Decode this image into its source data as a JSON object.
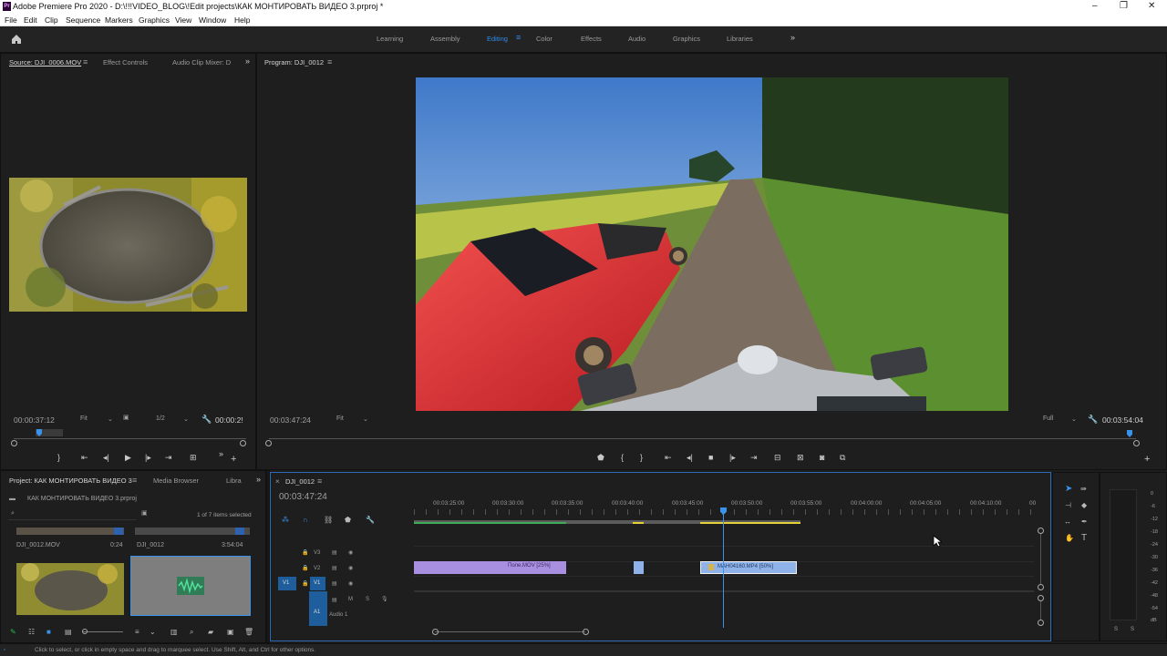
{
  "app": {
    "title": "Adobe Premiere Pro 2020 - D:\\!!!VIDEO_BLOG\\!Edit projects\\КАК МОНТИРОВАТЬ ВИДЕО 3.prproj *",
    "logo": "Pr"
  },
  "menu": [
    "File",
    "Edit",
    "Clip",
    "Sequence",
    "Markers",
    "Graphics",
    "View",
    "Window",
    "Help"
  ],
  "workspaces": [
    "Learning",
    "Assembly",
    "Editing",
    "Color",
    "Effects",
    "Audio",
    "Graphics",
    "Libraries"
  ],
  "active_workspace": "Editing",
  "source_panel": {
    "tabs": [
      "Source: DJI_0006.MOV",
      "Effect Controls",
      "Audio Clip Mixer: D"
    ],
    "timecode": "00:00:37:12",
    "fit": "Fit",
    "resolution": "1/2",
    "duration": "00:00:2!"
  },
  "program_panel": {
    "tab": "Program: DJI_0012",
    "timecode": "00:03:47:24",
    "fit": "Fit",
    "quality": "Full",
    "duration": "00:03:54:04"
  },
  "project_panel": {
    "tabs": [
      "Project: КАК МОНТИРОВАТЬ ВИДЕО 3",
      "Media Browser",
      "Libra"
    ],
    "project_name": "КАК МОНТИРОВАТЬ ВИДЕО 3.prproj",
    "selection_info": "1 of 7 items selected",
    "items": [
      {
        "name": "DJI_0012.MOV",
        "duration": "0:24"
      },
      {
        "name": "DJI_0012",
        "duration": "3:54:04"
      }
    ]
  },
  "timeline": {
    "tab": "DJI_0012",
    "timecode": "00:03:47:24",
    "ruler": [
      "00:03:25:00",
      "00:03:30:00",
      "00:03:35:00",
      "00:03:40:00",
      "00:03:45:00",
      "00:03:50:00",
      "00:03:55:00",
      "00:04:00:00",
      "00:04:05:00",
      "00:04:10:00",
      "00"
    ],
    "tracks": {
      "v3": "V3",
      "v2": "V2",
      "v1": "V1",
      "v1_src": "V1",
      "a1": "A1",
      "a1_name": "Audio 1",
      "m": "M",
      "s": "S"
    },
    "clips": [
      {
        "label": "Поле.MOV [25%]",
        "color": "#a98fe0"
      },
      {
        "label": "MAH04160.MP4 [50%]",
        "color": "#8fb3e8"
      }
    ]
  },
  "audio_meter": {
    "scale": [
      "0",
      "-6",
      "-12",
      "-18",
      "-24",
      "-30",
      "-36",
      "-42",
      "-48",
      "-54",
      "dB"
    ],
    "solo": [
      "S",
      "S"
    ]
  },
  "status_bar": "Click to select, or click in empty space and drag to marquee select. Use Shift, Alt, and Ctrl for other options.",
  "colors": {
    "accent": "#2d8ceb",
    "clip_purple": "#a98fe0",
    "clip_blue": "#8fb3e8",
    "panel_bg": "#1e1e1e"
  }
}
